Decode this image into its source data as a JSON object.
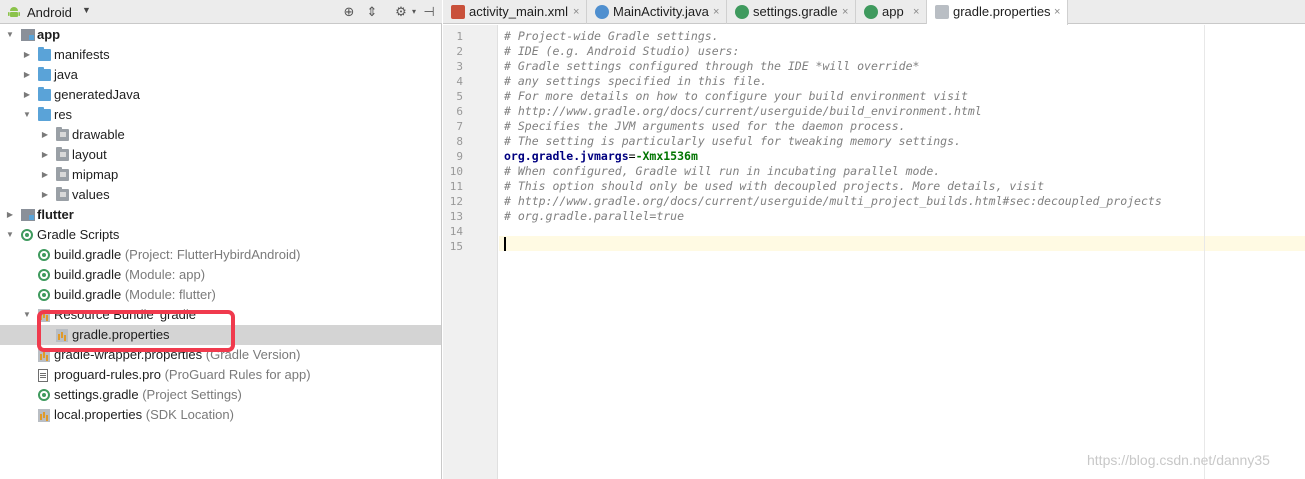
{
  "project_panel": {
    "view_title": "Android",
    "tree": [
      {
        "label": "app",
        "bold": true,
        "hint": "",
        "indent": 0,
        "arrow": "open",
        "icon": "module-icon"
      },
      {
        "label": "manifests",
        "hint": "",
        "indent": 1,
        "arrow": "closed",
        "icon": "folder-icon"
      },
      {
        "label": "java",
        "hint": "",
        "indent": 1,
        "arrow": "closed",
        "icon": "folder-icon"
      },
      {
        "label": "generatedJava",
        "hint": "",
        "indent": 1,
        "arrow": "closed",
        "icon": "generated-folder-icon"
      },
      {
        "label": "res",
        "hint": "",
        "indent": 1,
        "arrow": "open",
        "icon": "res-folder-icon"
      },
      {
        "label": "drawable",
        "hint": "",
        "indent": 2,
        "arrow": "closed",
        "icon": "folder-icon"
      },
      {
        "label": "layout",
        "hint": "",
        "indent": 2,
        "arrow": "closed",
        "icon": "folder-icon"
      },
      {
        "label": "mipmap",
        "hint": "",
        "indent": 2,
        "arrow": "closed",
        "icon": "folder-icon"
      },
      {
        "label": "values",
        "hint": "",
        "indent": 2,
        "arrow": "closed",
        "icon": "folder-icon"
      },
      {
        "label": "flutter",
        "bold": true,
        "hint": "",
        "indent": 0,
        "arrow": "closed",
        "icon": "module-icon"
      },
      {
        "label": "Gradle Scripts",
        "hint": "",
        "indent": 0,
        "arrow": "open",
        "icon": "gradle-icon"
      },
      {
        "label": "build.gradle",
        "hint": "(Project: FlutterHybirdAndroid)",
        "indent": 1,
        "arrow": "",
        "icon": "gradle-icon"
      },
      {
        "label": "build.gradle",
        "hint": "(Module: app)",
        "indent": 1,
        "arrow": "",
        "icon": "gradle-icon"
      },
      {
        "label": "build.gradle",
        "hint": "(Module: flutter)",
        "indent": 1,
        "arrow": "",
        "icon": "gradle-icon"
      },
      {
        "label": "Resource Bundle 'gradle'",
        "hint": "",
        "indent": 1,
        "arrow": "open",
        "icon": "bundle-icon"
      },
      {
        "label": "gradle.properties",
        "hint": "",
        "indent": 2,
        "arrow": "",
        "icon": "properties-icon",
        "selected": true
      },
      {
        "label": "gradle-wrapper.properties",
        "hint": "(Gradle Version)",
        "indent": 1,
        "arrow": "",
        "icon": "properties-icon"
      },
      {
        "label": "proguard-rules.pro",
        "hint": "(ProGuard Rules for app)",
        "indent": 1,
        "arrow": "",
        "icon": "file-icon"
      },
      {
        "label": "settings.gradle",
        "hint": "(Project Settings)",
        "indent": 1,
        "arrow": "",
        "icon": "gradle-icon"
      },
      {
        "label": "local.properties",
        "hint": "(SDK Location)",
        "indent": 1,
        "arrow": "",
        "icon": "properties-icon"
      }
    ]
  },
  "tabs": [
    {
      "label": "activity_main.xml",
      "icon": "xml-file-icon",
      "color": "#c9513b",
      "active": false
    },
    {
      "label": "MainActivity.java",
      "icon": "java-class-icon",
      "color": "#4f8fcf",
      "active": false
    },
    {
      "label": "settings.gradle",
      "icon": "gradle-icon",
      "color": "#3f9a5e",
      "active": false
    },
    {
      "label": "app",
      "icon": "gradle-icon",
      "color": "#3f9a5e",
      "active": false
    },
    {
      "label": "gradle.properties",
      "icon": "properties-icon",
      "color": "#b9bec4",
      "active": true
    }
  ],
  "editor": {
    "line_numbers": [
      "1",
      "2",
      "3",
      "4",
      "5",
      "6",
      "7",
      "8",
      "9",
      "10",
      "11",
      "12",
      "13",
      "14",
      "15"
    ],
    "lines": [
      {
        "type": "comment",
        "text": "# Project-wide Gradle settings."
      },
      {
        "type": "comment",
        "text": "# IDE (e.g. Android Studio) users:"
      },
      {
        "type": "comment",
        "text": "# Gradle settings configured through the IDE *will override*"
      },
      {
        "type": "comment",
        "text": "# any settings specified in this file."
      },
      {
        "type": "comment",
        "text": "# For more details on how to configure your build environment visit"
      },
      {
        "type": "comment",
        "text": "# http://www.gradle.org/docs/current/userguide/build_environment.html"
      },
      {
        "type": "comment",
        "text": "# Specifies the JVM arguments used for the daemon process."
      },
      {
        "type": "comment",
        "text": "# The setting is particularly useful for tweaking memory settings."
      },
      {
        "type": "property",
        "key": "org.gradle.jvmargs",
        "eq": "=",
        "value": "-Xmx1536m"
      },
      {
        "type": "comment",
        "text": "# When configured, Gradle will run in incubating parallel mode."
      },
      {
        "type": "comment",
        "text": "# This option should only be used with decoupled projects. More details, visit"
      },
      {
        "type": "comment",
        "text": "# http://www.gradle.org/docs/current/userguide/multi_project_builds.html#sec:decoupled_projects"
      },
      {
        "type": "comment",
        "text": "# org.gradle.parallel=true"
      },
      {
        "type": "empty",
        "text": ""
      },
      {
        "type": "empty",
        "text": ""
      }
    ]
  },
  "watermark": "https://blog.csdn.net/danny35",
  "colors": {
    "highlight": "#f03a4d",
    "selection": "#d4d4d4",
    "caret_line": "#fffae3"
  }
}
